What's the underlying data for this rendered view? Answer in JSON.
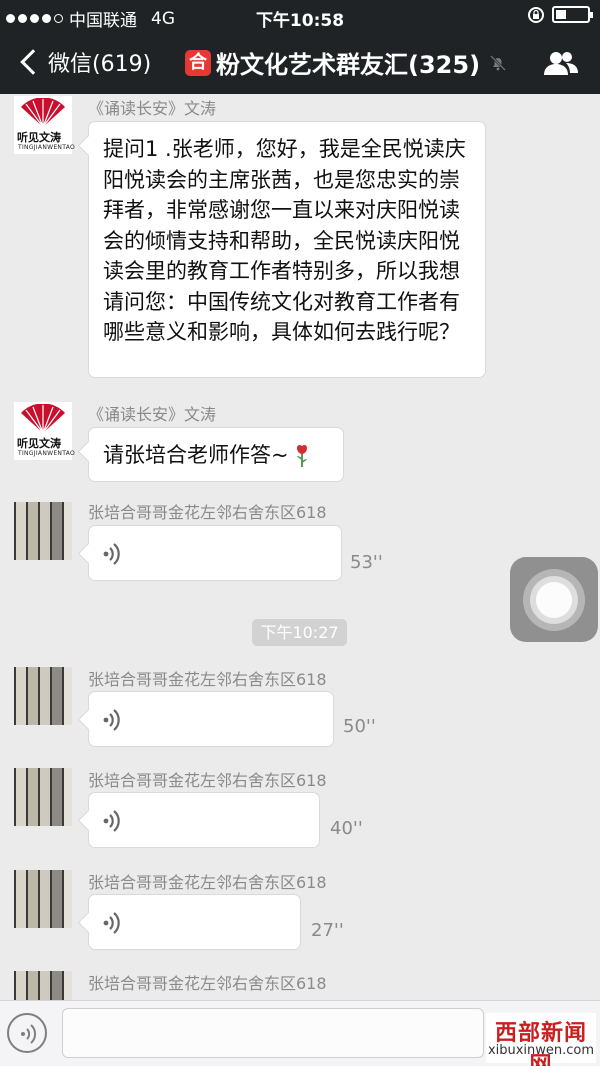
{
  "status_bar": {
    "carrier": "中国联通",
    "network": "4G",
    "time": "下午10:58"
  },
  "nav": {
    "back_label": "微信(619)",
    "title_badge": "合",
    "title": "粉文化艺术群友汇(325)"
  },
  "messages": {
    "m1": {
      "sender": "《诵读长安》文涛",
      "text": "提问1 .张老师，您好，我是全民悦读庆阳悦读会的主席张茜，也是您忠实的崇拜者，非常感谢您一直以来对庆阳悦读会的倾情支持和帮助，全民悦读庆阳悦读会里的教育工作者特别多，所以我想请问您：中国传统文化对教育工作者有哪些意义和影响，具体如何去践行呢？"
    },
    "m2": {
      "sender": "《诵读长安》文涛",
      "text": "请张培合老师作答~"
    },
    "m3": {
      "sender": "张培合哥哥金花左邻右舍东区618",
      "duration": "53''"
    },
    "timestamp": "下午10:27",
    "m4": {
      "sender": "张培合哥哥金花左邻右舍东区618",
      "duration": "50''"
    },
    "m5": {
      "sender": "张培合哥哥金花左邻右舍东区618",
      "duration": "40''"
    },
    "m6": {
      "sender": "张培合哥哥金花左邻右舍东区618",
      "duration": "27''"
    },
    "m7": {
      "sender": "张培合哥哥金花左邻右舍东区618"
    }
  },
  "avatar_fan": {
    "caption": "听见文涛",
    "caption_en": "TINGJIANWENTAO"
  },
  "watermark": {
    "line1": "西部新闻网",
    "line2": "xibuxinwen.com"
  },
  "input": {
    "value": ""
  },
  "colors": {
    "header_bg": "#202326",
    "chat_bg": "#ebebeb",
    "badge_red": "#e53935",
    "watermark_red": "#c91f1f"
  }
}
